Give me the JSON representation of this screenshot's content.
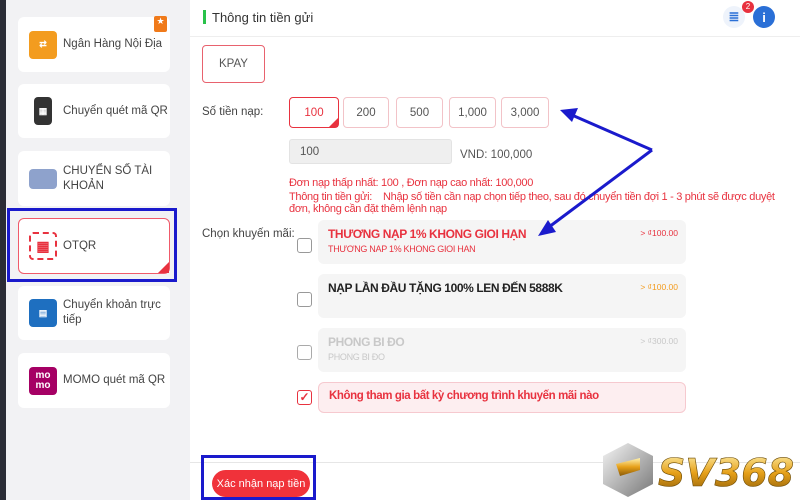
{
  "sidebar": {
    "items": [
      {
        "label": "Ngân Hàng Nội Địa",
        "icon": "bank-transfer-icon",
        "color": "#f39c1f",
        "hot": true
      },
      {
        "label": "Chuyển quét mã QR",
        "icon": "phone-qr-icon",
        "color": "#333333"
      },
      {
        "label": "CHUYỂN SỐ TÀI KHOẢN",
        "icon": "card-icon",
        "color": "#6f86b8"
      },
      {
        "label": "OTQR",
        "icon": "qr-scan-icon",
        "color": "#e8323f",
        "selected": true
      },
      {
        "label": "Chuyển khoản trực tiếp",
        "icon": "mobile-transfer-icon",
        "color": "#1e6fc0"
      },
      {
        "label": "MOMO quét mã QR",
        "icon": "momo-icon",
        "color": "#a50064",
        "icon_text": "mo mo"
      }
    ]
  },
  "header": {
    "title": "Thông tin tiền gửi",
    "notification_count": "2",
    "icons": [
      "deposit-history-icon",
      "info-icon"
    ]
  },
  "channel": {
    "label": "KPAY"
  },
  "amount": {
    "label": "Số tiền nạp:",
    "options": [
      "100",
      "200",
      "500",
      "1,000",
      "3,000"
    ],
    "selected": "100",
    "input_value": "100",
    "vnd": "VND: 100,000",
    "limits": "Đơn nạp thấp nhất:  100 ,  Đơn nạp cao nhất:  100,000",
    "info_label": "Thông tin tiền gửi:",
    "info_text": "Nhập số tiền cần nạp chọn tiếp theo, sau đó chuyển tiền đợi 1 - 3 phút sẽ được duyệt đơn, không cần đặt thêm lệnh nạp"
  },
  "promotions": {
    "label": "Chọn khuyến mãi:",
    "items": [
      {
        "title": "THƯƠNG NẠP 1% KHONG GIOI HẠN",
        "subtitle": "THƯƠNG NAP 1% KHONG GIOI HAN",
        "price": "> ₫100.00",
        "checked": false
      },
      {
        "title": "NẠP LẦN ĐẦU TẶNG 100% LEN ĐẾN 5888K",
        "subtitle": "",
        "price": "> ₫100.00",
        "checked": false
      },
      {
        "title": "PHONG BI ĐO",
        "subtitle": "PHONG BI ĐO",
        "price": "> ₫300.00",
        "checked": false,
        "disabled": true
      },
      {
        "title": "Không tham gia bất kỳ chương trình khuyến mãi nào",
        "checked": true
      }
    ]
  },
  "footer": {
    "confirm_label": "Xác nhận nạp tiền"
  },
  "logo": {
    "text": "SV368"
  },
  "colors": {
    "accent": "#e8323f",
    "annotation": "#1a1acc",
    "green": "#29c24a"
  }
}
